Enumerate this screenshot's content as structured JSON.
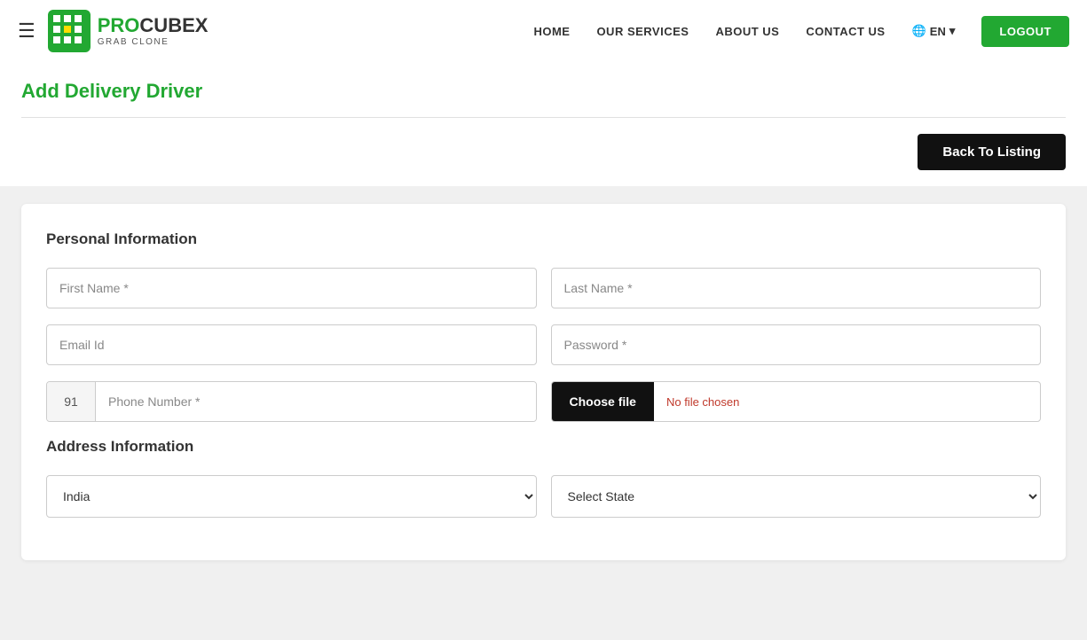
{
  "navbar": {
    "hamburger_label": "☰",
    "logo_brand_1": "PRO",
    "logo_brand_2": "CUBEX",
    "logo_sub": "GRAB CLONE",
    "nav_links": [
      "HOME",
      "OUR SERVICES",
      "ABOUT US",
      "CONTACT US"
    ],
    "lang_label": "🌐 EN",
    "lang_chevron": "▾",
    "logout_label": "LOGOUT"
  },
  "page": {
    "title": "Add Delivery Driver",
    "back_button": "Back To Listing"
  },
  "personal_info": {
    "section_title": "Personal Information",
    "first_name_placeholder": "First Name",
    "first_name_required": "*",
    "last_name_placeholder": "Last Name",
    "last_name_required": "*",
    "email_placeholder": "Email Id",
    "password_placeholder": "Password",
    "password_required": "*",
    "phone_code": "91",
    "phone_placeholder": "Phone Number",
    "phone_required": "*",
    "file_btn_label": "Choose file",
    "file_status": "No file chosen"
  },
  "address_info": {
    "section_title": "Address Information",
    "country_options": [
      "India"
    ],
    "country_selected": "India",
    "state_placeholder": "Select State"
  }
}
